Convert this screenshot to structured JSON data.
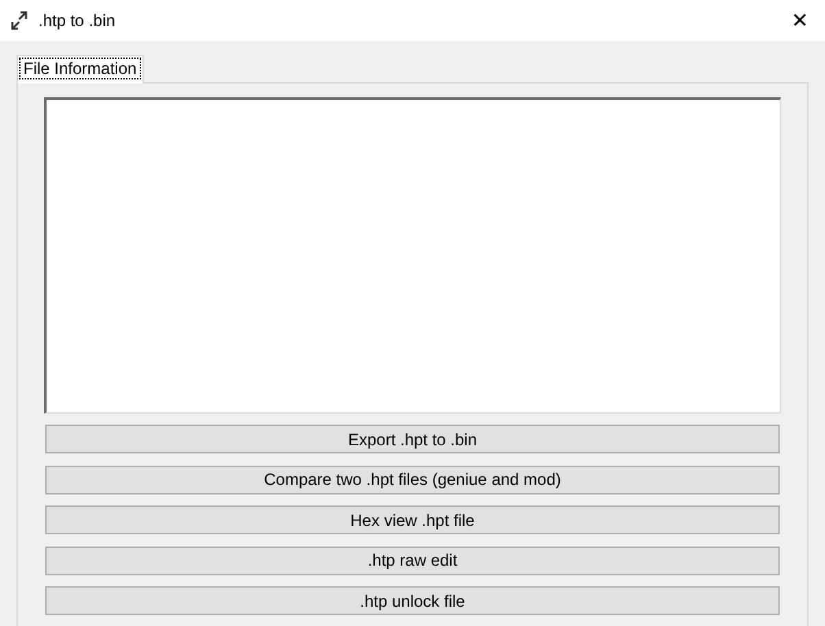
{
  "window": {
    "title": ".htp to .bin",
    "close": "✕"
  },
  "tabs": [
    {
      "label": "File Information",
      "selected": true
    }
  ],
  "buttons": [
    {
      "label": "Export .hpt to .bin"
    },
    {
      "label": "Compare two .hpt files (geniue and mod)"
    },
    {
      "label": "Hex view .hpt file"
    },
    {
      "label": ".htp raw edit"
    },
    {
      "label": ".htp unlock file"
    }
  ]
}
